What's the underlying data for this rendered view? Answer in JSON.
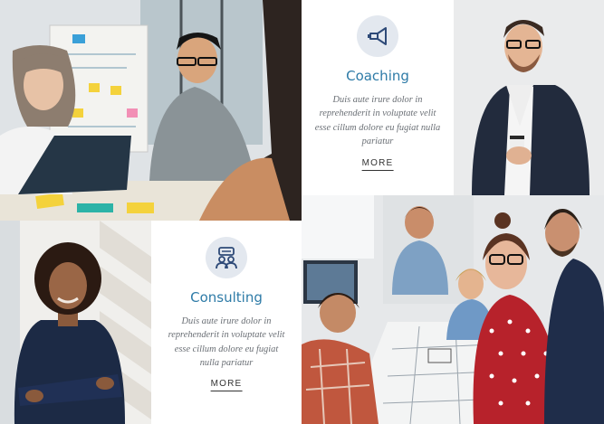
{
  "cards": [
    {
      "icon": "megaphone-icon",
      "title": "Coaching",
      "body": "Duis aute irure dolor in reprehenderit in voluptate velit esse cillum dolore eu fugiat nulla pariatur",
      "link": "MORE"
    },
    {
      "icon": "team-icon",
      "title": "Consulting",
      "body": "Duis aute irure dolor in reprehenderit in voluptate velit esse cillum dolore eu fugiat nulla pariatur",
      "link": "MORE"
    }
  ],
  "colors": {
    "accent": "#2e7ba7",
    "icon_bg": "#e3e8ef",
    "body_text": "#6a6f75"
  }
}
